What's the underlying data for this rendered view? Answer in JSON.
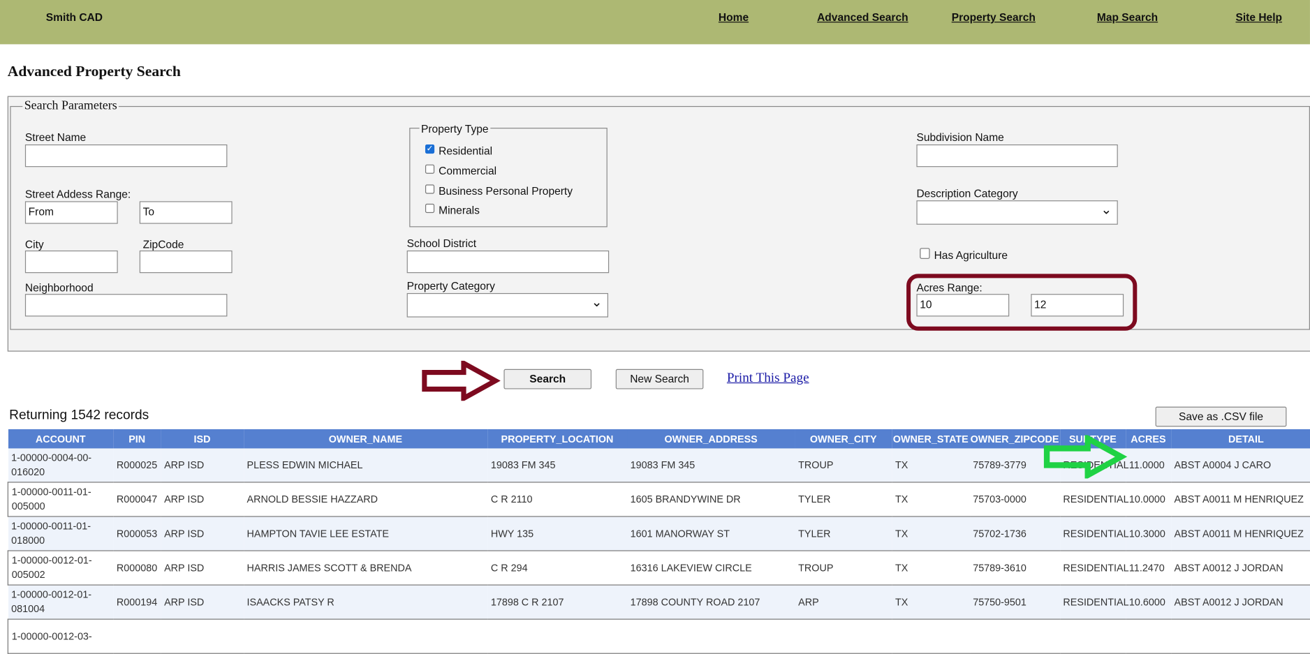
{
  "header": {
    "brand": "Smith CAD",
    "nav": [
      "Home",
      "Advanced Search",
      "Property Search",
      "Map Search",
      "Site Help"
    ]
  },
  "page_title": "Advanced Property Search",
  "form": {
    "legend": "Search Parameters",
    "street_name_label": "Street Name",
    "street_name_value": "",
    "address_range_label": "Street Addess Range:",
    "from_value": "From",
    "to_value": "To",
    "city_label": "City",
    "zip_label": "ZipCode",
    "neighborhood_label": "Neighborhood",
    "property_type": {
      "legend": "Property Type",
      "options": [
        {
          "label": "Residential",
          "checked": true
        },
        {
          "label": "Commercial",
          "checked": false
        },
        {
          "label": "Business Personal Property",
          "checked": false
        },
        {
          "label": "Minerals",
          "checked": false
        }
      ]
    },
    "school_district_label": "School District",
    "property_category_label": "Property Category",
    "property_category_value": "",
    "subdivision_label": "Subdivision Name",
    "description_category_label": "Description Category",
    "description_category_value": "",
    "has_agriculture_label": "Has Agriculture",
    "has_agriculture_checked": false,
    "acres_label": "Acres Range:",
    "acres_from": "10",
    "acres_to": "12"
  },
  "actions": {
    "search": "Search",
    "new_search": "New Search",
    "print": "Print This Page"
  },
  "results": {
    "count_text": "Returning 1542 records",
    "csv_button": "Save as .CSV file",
    "columns": [
      "ACCOUNT",
      "PIN",
      "ISD",
      "OWNER_NAME",
      "PROPERTY_LOCATION",
      "OWNER_ADDRESS",
      "OWNER_CITY",
      "OWNER_STATE",
      "OWNER_ZIPCODE",
      "SUBTYPE",
      "ACRES",
      "DETAIL"
    ],
    "rows": [
      [
        "1-00000-0004-00-016020",
        "R000025",
        "ARP ISD",
        "PLESS EDWIN MICHAEL",
        "19083 FM 345",
        "19083 FM 345",
        "TROUP",
        "TX",
        "75789-3779",
        "RESIDENTIAL",
        "11.0000",
        "ABST A0004 J CARO"
      ],
      [
        "1-00000-0011-01-005000",
        "R000047",
        "ARP ISD",
        "ARNOLD BESSIE HAZZARD",
        "C R 2110",
        "1605 BRANDYWINE DR",
        "TYLER",
        "TX",
        "75703-0000",
        "RESIDENTIAL",
        "10.0000",
        "ABST A0011 M HENRIQUEZ"
      ],
      [
        "1-00000-0011-01-018000",
        "R000053",
        "ARP ISD",
        "HAMPTON TAVIE LEE ESTATE",
        "HWY 135",
        "1601 MANORWAY ST",
        "TYLER",
        "TX",
        "75702-1736",
        "RESIDENTIAL",
        "10.3000",
        "ABST A0011 M HENRIQUEZ"
      ],
      [
        "1-00000-0012-01-005002",
        "R000080",
        "ARP ISD",
        "HARRIS JAMES SCOTT & BRENDA",
        "C R 294",
        "16316 LAKEVIEW CIRCLE",
        "TROUP",
        "TX",
        "75789-3610",
        "RESIDENTIAL",
        "11.2470",
        "ABST A0012 J JORDAN"
      ],
      [
        "1-00000-0012-01-081004",
        "R000194",
        "ARP ISD",
        "ISAACKS PATSY R",
        "17898 C R 2107",
        "17898 COUNTY ROAD 2107",
        "ARP",
        "TX",
        "75750-9501",
        "RESIDENTIAL",
        "10.6000",
        "ABST A0012 J JORDAN"
      ],
      [
        "1-00000-0012-03-",
        "",
        "",
        "",
        "",
        "",
        "",
        "",
        "",
        "",
        "",
        ""
      ]
    ]
  },
  "annotations": {
    "search_arrow_color": "#7d0a1f",
    "acres_arrow_color": "#1fd244",
    "highlight_color": "#7d0a1f"
  }
}
